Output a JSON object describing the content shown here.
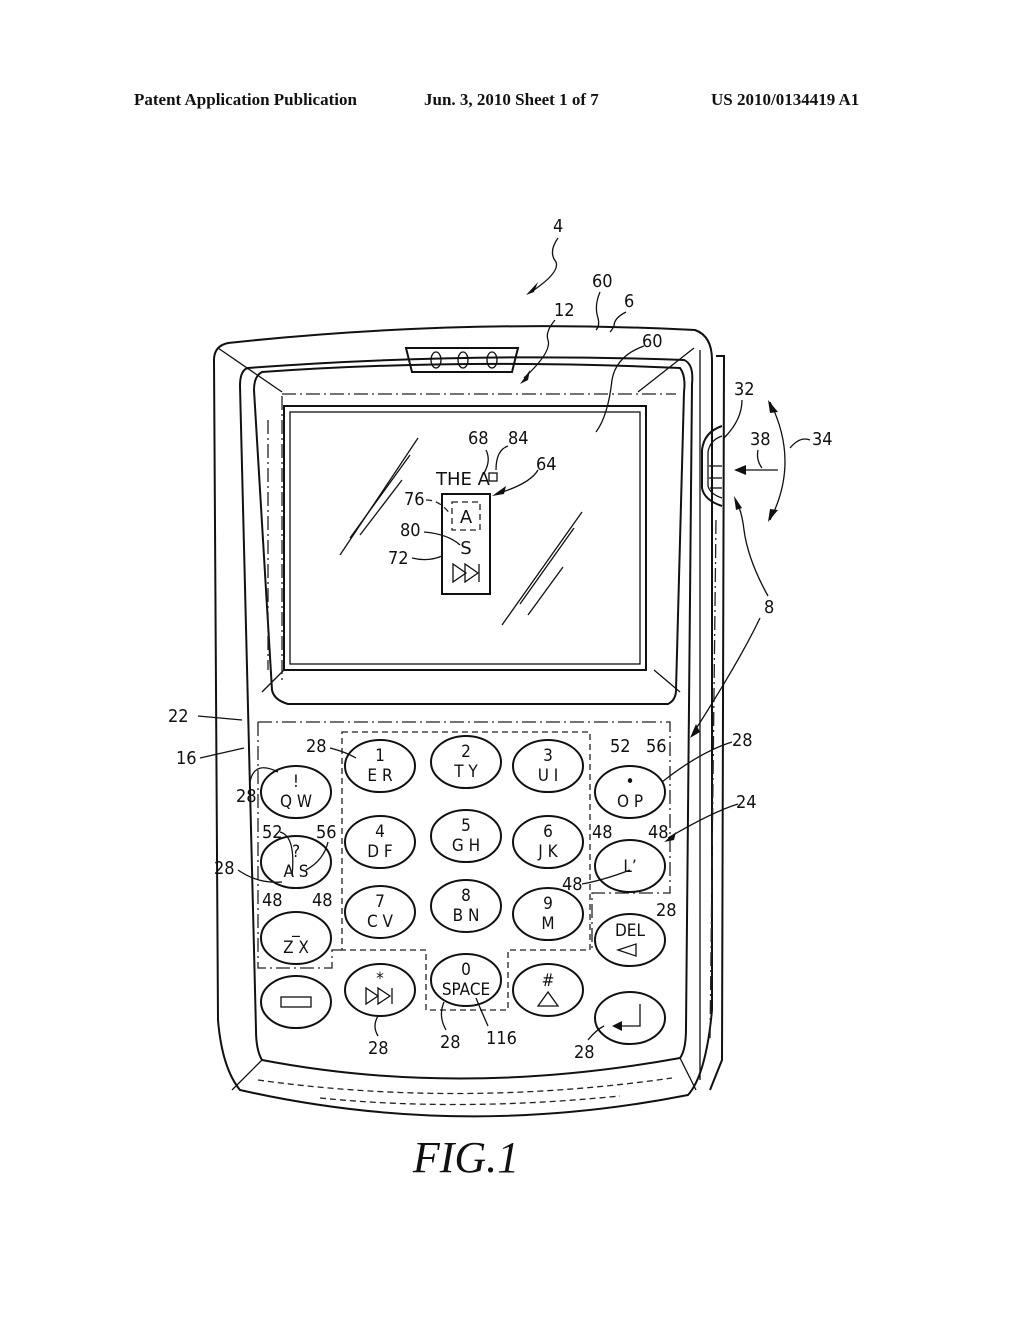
{
  "header": {
    "left": "Patent Application Publication",
    "middle": "Jun. 3, 2010   Sheet 1 of 7",
    "right": "US 2010/0134419 A1"
  },
  "figure": {
    "caption": "FIG.1",
    "screen": {
      "text_line": "THE A",
      "cursor_symbol": "□",
      "popup_selected": "A",
      "popup_alternate": "S",
      "popup_next_icon": "next-icon"
    },
    "keys": [
      {
        "id": "qw",
        "top": "!",
        "bottom": "Q W"
      },
      {
        "id": "as",
        "top": "?",
        "bottom": "A S"
      },
      {
        "id": "zx",
        "top": "_",
        "bottom": "Z X"
      },
      {
        "id": "er",
        "top": "1",
        "bottom": "E R"
      },
      {
        "id": "ty",
        "top": "2",
        "bottom": "T Y"
      },
      {
        "id": "ui",
        "top": "3",
        "bottom": "U I"
      },
      {
        "id": "df",
        "top": "4",
        "bottom": "D F"
      },
      {
        "id": "gh",
        "top": "5",
        "bottom": "G H"
      },
      {
        "id": "jk",
        "top": "6",
        "bottom": "J K"
      },
      {
        "id": "cv",
        "top": "7",
        "bottom": "C V"
      },
      {
        "id": "bn",
        "top": "8",
        "bottom": "B N"
      },
      {
        "id": "m",
        "top": "9",
        "bottom": "M"
      },
      {
        "id": "op",
        "top": "•",
        "bottom": "O P"
      },
      {
        "id": "l",
        "top": "",
        "bottom": "L’"
      },
      {
        "id": "del",
        "top": "DEL",
        "bottom": "◁"
      },
      {
        "id": "menu",
        "top": "",
        "bottom": "▭"
      },
      {
        "id": "star",
        "top": "*",
        "bottom": "⏭"
      },
      {
        "id": "space",
        "top": "0",
        "bottom": "SPACE"
      },
      {
        "id": "hash",
        "top": "#",
        "bottom": "△"
      },
      {
        "id": "enter",
        "top": "",
        "bottom": "↵"
      }
    ],
    "reference_numerals": {
      "device": "4",
      "housing": "6",
      "input_apparatus": "8",
      "display": "12",
      "keypad": "16",
      "front_face": "22",
      "keys_group": "24",
      "key": "28",
      "thumbwheel": "32",
      "rotation": "34",
      "translation": "38",
      "linguistic_element": "48",
      "first_portion": "52",
      "second_portion": "56",
      "housing_edge": "60",
      "output": "64",
      "text_input": "68",
      "popup": "72",
      "default_output": "76",
      "variant_output": "80",
      "cursor": "84",
      "space_key": "116"
    }
  }
}
